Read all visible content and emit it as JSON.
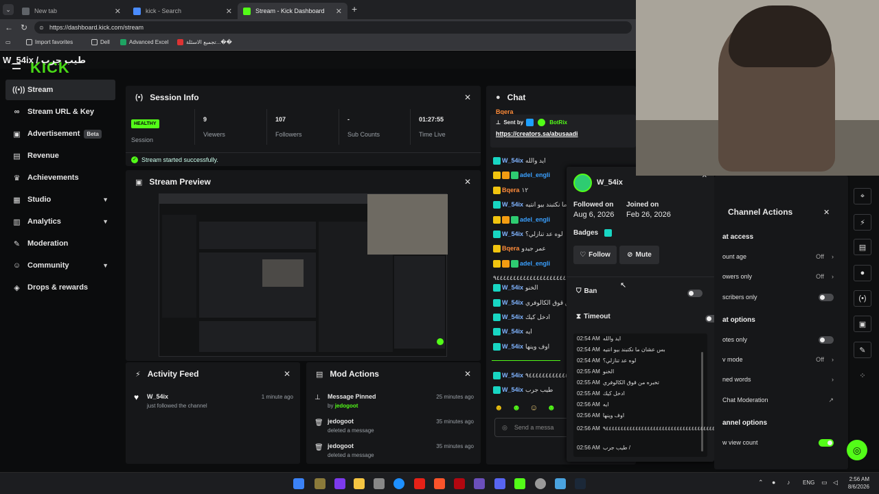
{
  "browser": {
    "tabs": [
      {
        "title": "New tab",
        "active": false
      },
      {
        "title": "kick - Search",
        "active": false
      },
      {
        "title": "Stream - Kick Dashboard",
        "active": true
      }
    ],
    "new_tab": "+",
    "url": "https://dashboard.kick.com/stream",
    "bookmarks": [
      {
        "label": "Import favorites"
      },
      {
        "label": "Dell"
      },
      {
        "label": "Advanced Excel"
      },
      {
        "label": "تجميع الاسئلة...��"
      }
    ]
  },
  "header": {
    "breadcrumb": "W_54ix / طيب جرب",
    "logo": "KICK"
  },
  "sidebar": {
    "items": [
      {
        "label": "Stream",
        "icon": "broadcast-icon"
      },
      {
        "label": "Stream URL & Key",
        "icon": "link-icon"
      },
      {
        "label": "Advertisement",
        "badge": "Beta",
        "icon": "ad-icon"
      },
      {
        "label": "Revenue",
        "icon": "revenue-icon"
      },
      {
        "label": "Achievements",
        "icon": "trophy-icon"
      },
      {
        "label": "Studio",
        "icon": "studio-icon"
      },
      {
        "label": "Analytics",
        "icon": "analytics-icon"
      },
      {
        "label": "Moderation",
        "icon": "wrench-icon"
      },
      {
        "label": "Community",
        "icon": "people-icon"
      },
      {
        "label": "Drops & rewards",
        "icon": "gift-icon"
      }
    ]
  },
  "session": {
    "title": "Session Info",
    "status": "HEALTHY",
    "status_label": "Session",
    "viewers": "9",
    "viewers_label": "Viewers",
    "followers": "107",
    "followers_label": "Followers",
    "subs": "-",
    "subs_label": "Sub Counts",
    "time": "01:27:55",
    "time_label": "Time Live",
    "notice": "Stream started successfully."
  },
  "preview": {
    "title": "Stream Preview"
  },
  "activity": {
    "title": "Activity Feed",
    "items": [
      {
        "user": "W_54ix",
        "desc": "just followed the channel",
        "time": "1 minute ago"
      }
    ]
  },
  "mod_actions": {
    "title": "Mod Actions",
    "items": [
      {
        "action": "Message Pinned",
        "by": "by",
        "user": "jedogoot",
        "time": "25 minutes ago"
      },
      {
        "action": "jedogoot",
        "by": "",
        "user": "deleted a message",
        "time": "35 minutes ago"
      },
      {
        "action": "jedogoot",
        "by": "",
        "user": "deleted a message",
        "time": "35 minutes ago"
      }
    ]
  },
  "chat": {
    "title": "Chat",
    "pinned_user": "Bqera",
    "sent_by": "Sent by",
    "bot": "BotRix",
    "pinned_link": "https://creators.sa/abusaadi",
    "messages": [
      {
        "badges": [
          "sub"
        ],
        "user": "W_54ix",
        "color": "#7fb3ff",
        "text": "ايد والله"
      },
      {
        "badges": [
          "10",
          "crown",
          "teal"
        ],
        "user": "adel_engli",
        "color": "#3aa0ff",
        "text": ""
      },
      {
        "badges": [
          "10"
        ],
        "user": "Bqera",
        "color": "#ff8c3a",
        "text": "١٢"
      },
      {
        "badges": [
          "sub"
        ],
        "user": "W_54ix",
        "color": "#7fb3ff",
        "text": "بس عشان ما نكتبند بيو انتيه"
      },
      {
        "badges": [
          "10",
          "crown",
          "teal"
        ],
        "user": "adel_engli",
        "color": "#3aa0ff",
        "text": ""
      },
      {
        "badges": [
          "sub"
        ],
        "user": "W_54ix",
        "color": "#7fb3ff",
        "text": "لوه عد تنازلي؟"
      },
      {
        "badges": [
          "10"
        ],
        "user": "Bqera",
        "color": "#ff8c3a",
        "text": "عمر جيدو"
      },
      {
        "badges": [
          "10",
          "crown",
          "teal"
        ],
        "user": "adel_engli",
        "color": "#3aa0ff",
        "text": ""
      },
      {
        "badges": [],
        "user": "",
        "color": "#ddd",
        "text": "٩٤٤٤٤٤٤٤٤٤٤٤٤٤٤٤٤٤٤٤٤٤٤٤٤٤٤٤٤"
      },
      {
        "badges": [
          "sub"
        ],
        "user": "W_54ix",
        "color": "#7fb3ff",
        "text": "الخنو"
      },
      {
        "badges": [
          "sub"
        ],
        "user": "W_54ix",
        "color": "#7fb3ff",
        "text": "تخبره من قوق الكالوفري"
      },
      {
        "badges": [
          "sub"
        ],
        "user": "W_54ix",
        "color": "#7fb3ff",
        "text": "ادخل كيك"
      },
      {
        "badges": [
          "sub"
        ],
        "user": "W_54ix",
        "color": "#7fb3ff",
        "text": "ايه"
      },
      {
        "badges": [
          "sub"
        ],
        "user": "W_54ix",
        "color": "#7fb3ff",
        "text": "اوف وينها"
      },
      {
        "badges": [
          "sub"
        ],
        "user": "W_54ix",
        "color": "#7fb3ff",
        "text": "٩٤٤٤٤٤٤٤٤٤٤٤٤٤٤٤٤٤٤٤٤٤"
      },
      {
        "badges": [
          "sub"
        ],
        "user": "W_54ix",
        "color": "#7fb3ff",
        "text": "طيب جرب"
      }
    ],
    "send_placeholder": "Send a messa"
  },
  "user_card": {
    "name": "W_54ix",
    "followed_label": "Followed on",
    "followed": "Aug 6, 2026",
    "joined_label": "Joined on",
    "joined": "Feb 26, 2026",
    "badges_label": "Badges",
    "follow": "Follow",
    "mute": "Mute",
    "ban": "Ban",
    "timeout": "Timeout",
    "history": [
      {
        "time": "02:54 AM",
        "text": "ايد والله"
      },
      {
        "time": "02:54 AM",
        "text": "بس عشان ما نكتبند بيو انتيه"
      },
      {
        "time": "02:54 AM",
        "text": "لوه عد تنازلي؟"
      },
      {
        "time": "02:55 AM",
        "text": "الخنو"
      },
      {
        "time": "02:55 AM",
        "text": "تخبره من قوق الكالوفري"
      },
      {
        "time": "02:55 AM",
        "text": "ادخل كيك"
      },
      {
        "time": "02:56 AM",
        "text": "ايه"
      },
      {
        "time": "02:56 AM",
        "text": "اوف وينها"
      },
      {
        "time": "02:56 AM",
        "text": "٩٤٤٤٤٤٤٤٤٤٤٤٤٤٤٤٤٤٤٤٤٤٤٤٤٤٤٤٤٤٤٤٤٤٤٤٤٤٤٤"
      },
      {
        "time": "02:56 AM",
        "text": "طيب جرب /"
      }
    ]
  },
  "channel_actions": {
    "title": "Channel Actions",
    "s1": "at access",
    "account_age": "ount age",
    "account_age_val": "Off",
    "followers_only": "owers only",
    "followers_only_val": "Off",
    "subs_only": "scribers only",
    "s2": "at options",
    "emotes_only": "otes only",
    "slow_mode": "v mode",
    "slow_mode_val": "Off",
    "banned_words": "ned words",
    "ai_mod": "Chat Moderation",
    "s3": "annel options",
    "view_count": "w view count"
  },
  "taskbar": {
    "lang": "ENG",
    "time": "2:56 AM",
    "date": "8/6/2026"
  },
  "colors": {
    "accent": "#53fc18",
    "panel": "#161719",
    "bg": "#0b0c0d"
  }
}
